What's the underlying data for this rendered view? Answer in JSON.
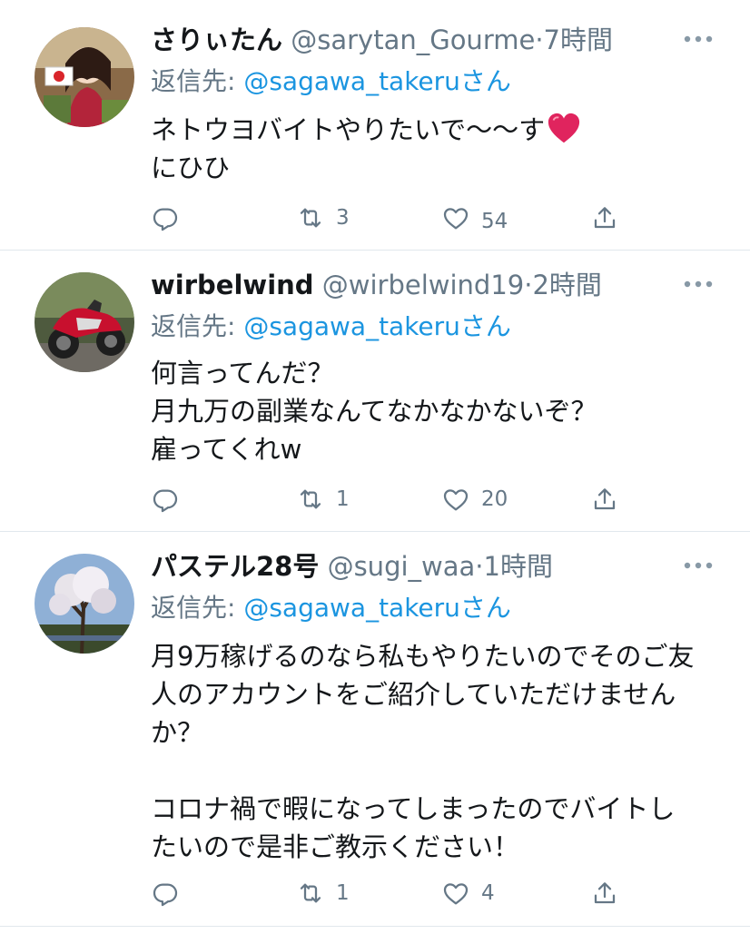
{
  "colors": {
    "text": "#14171a",
    "secondary": "#657786",
    "mention": "#1b95e0",
    "heart": "#e0245e",
    "divider": "#e1e8ed"
  },
  "tweets": [
    {
      "name": "さりぃたん",
      "handle": "@sarytan_Gourme",
      "dot": "·",
      "time": "7時間",
      "reply_prefix": "返信先: ",
      "reply_mention": "@sagawa_takeru",
      "reply_suffix": "さん",
      "lines": [
        "ネトウヨバイトやりたいで〜〜す",
        "にひひ"
      ],
      "emoji": "heart-emoji",
      "replies": "",
      "retweets": "3",
      "likes": "54",
      "avatar": "avatar-illustration-icon"
    },
    {
      "name": "wirbelwind",
      "handle": "@wirbelwind19",
      "dot": "·",
      "time": "2時間",
      "reply_prefix": "返信先: ",
      "reply_mention": "@sagawa_takeru",
      "reply_suffix": "さん",
      "lines": [
        "何言ってんだ？",
        "月九万の副業なんてなかなかないぞ？",
        "雇ってくれw"
      ],
      "replies": "",
      "retweets": "1",
      "likes": "20",
      "avatar": "avatar-motorcycle-icon"
    },
    {
      "name": "パステル28号",
      "handle": "@sugi_waa",
      "dot": "·",
      "time": "1時間",
      "reply_prefix": "返信先: ",
      "reply_mention": "@sagawa_takeru",
      "reply_suffix": "さん",
      "lines": [
        "月9万稼げるのなら私もやりたいのでそのご友",
        "人のアカウントをご紹介していただけません",
        "か？",
        "",
        "コロナ禍で暇になってしまったのでバイトし",
        "たいので是非ご教示ください！"
      ],
      "replies": "",
      "retweets": "1",
      "likes": "4",
      "avatar": "avatar-tree-icon"
    }
  ]
}
